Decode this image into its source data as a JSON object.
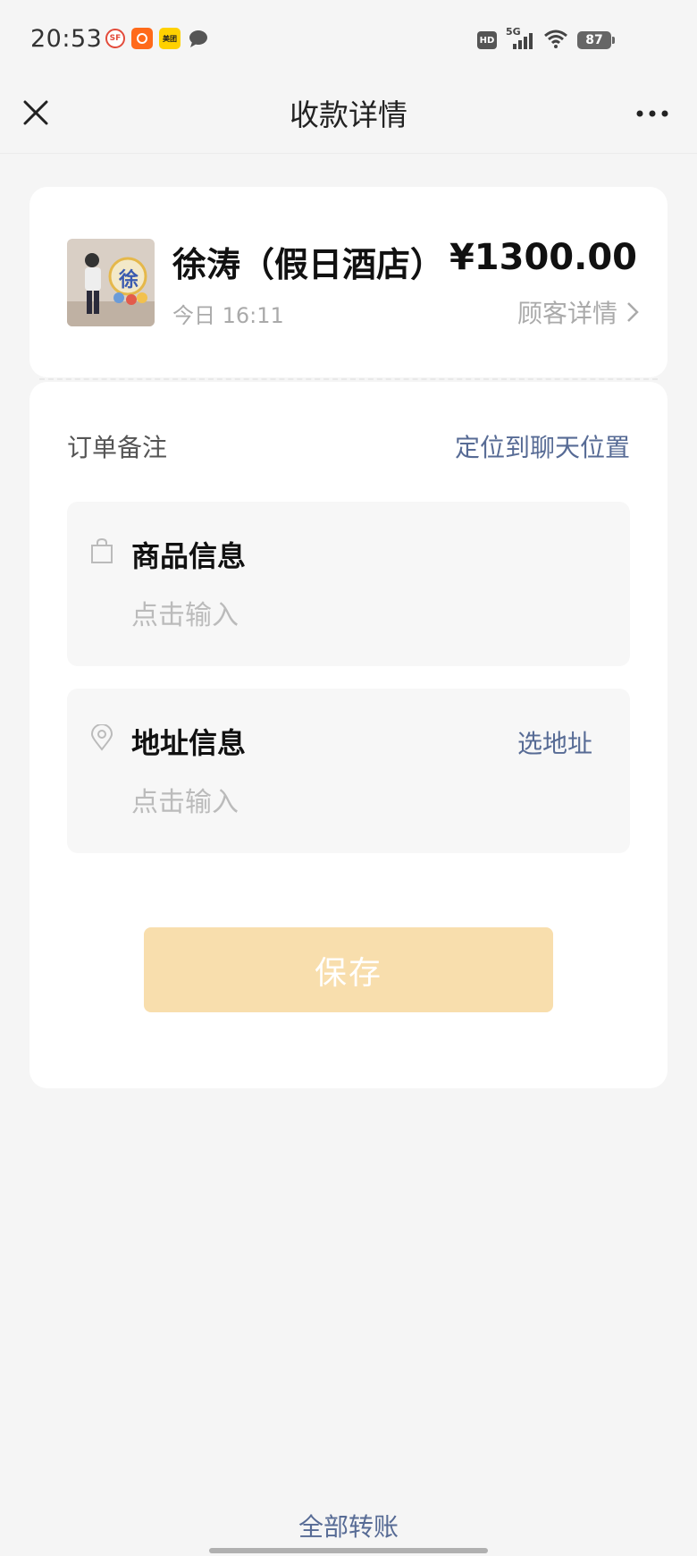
{
  "status_bar": {
    "time": "20:53",
    "notifications": [
      {
        "icon": "sf-express-icon",
        "label": "SF"
      },
      {
        "icon": "taobao-icon",
        "label": ""
      },
      {
        "icon": "meituan-icon",
        "label": "美团"
      },
      {
        "icon": "chat-bubble-icon",
        "label": ""
      }
    ],
    "hd": "HD",
    "network": "5G",
    "battery": "87"
  },
  "nav": {
    "title": "收款详情",
    "close_icon": "close-icon",
    "more_icon": "more-dots-icon"
  },
  "merchant": {
    "name": "徐涛（假日酒店）",
    "amount": "¥1300.00",
    "time": "今日 16:11",
    "customer_link": "顾客详情",
    "avatar_char": "徐"
  },
  "order": {
    "note_label": "订单备注",
    "locate_link": "定位到聊天位置",
    "goods": {
      "icon": "shopping-bag-icon",
      "title": "商品信息",
      "placeholder": "点击输入"
    },
    "address": {
      "icon": "location-pin-icon",
      "title": "地址信息",
      "placeholder": "点击输入",
      "select_label": "选地址"
    },
    "save_label": "保存"
  },
  "footer": {
    "all_transfers": "全部转账"
  },
  "colors": {
    "link": "#576b95",
    "save_button": "#f8dead",
    "background": "#f5f5f5"
  }
}
